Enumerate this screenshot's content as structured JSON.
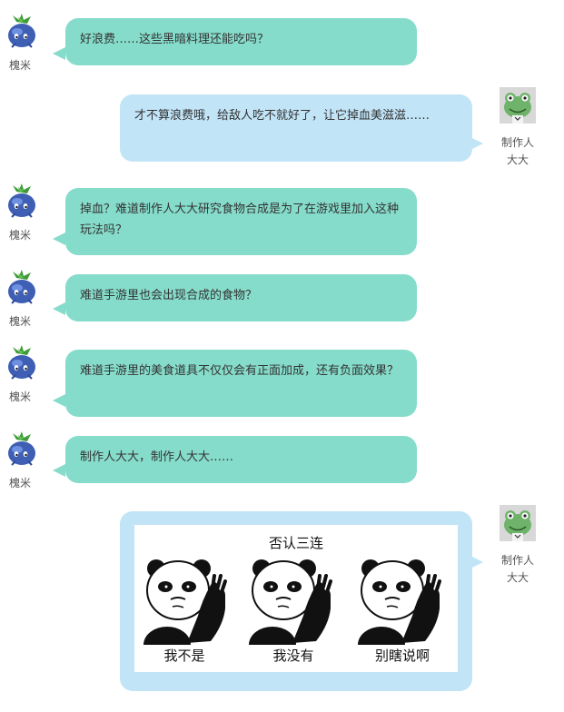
{
  "users": {
    "other": {
      "name": "槐米",
      "avatar": "blueberry-sprout-icon"
    },
    "me": {
      "name_line1": "制作人",
      "name_line2": "大大",
      "avatar": "frog-icon"
    }
  },
  "messages": [
    {
      "side": "left",
      "text": "好浪费……这些黑暗料理还能吃吗？"
    },
    {
      "side": "right",
      "text": "才不算浪费哦，给敌人吃不就好了，让它掉血美滋滋……"
    },
    {
      "side": "left",
      "text": "掉血？难道制作人大大研究食物合成是为了在游戏里加入这种玩法吗？"
    },
    {
      "side": "left",
      "text": "难道手游里也会出现合成的食物？"
    },
    {
      "side": "left",
      "text": "难道手游里的美食道具不仅仅会有正面加成，还有负面效果？"
    },
    {
      "side": "left",
      "text": "制作人大大，制作人大大……"
    }
  ],
  "meme": {
    "title": "否认三连",
    "captions": [
      "我不是",
      "我没有",
      "别瞎说啊"
    ]
  },
  "colors": {
    "left_bubble": "#86dccb",
    "right_bubble": "#c1e4f7"
  }
}
